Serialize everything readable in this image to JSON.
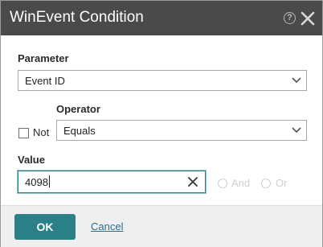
{
  "dialog": {
    "title": "WinEvent Condition"
  },
  "parameter": {
    "label": "Parameter",
    "selected": "Event ID"
  },
  "operator": {
    "label": "Operator",
    "selected": "Equals"
  },
  "not_checkbox": {
    "label": "Not",
    "checked": false
  },
  "value_field": {
    "label": "Value",
    "value": "4098"
  },
  "logic": {
    "and_label": "And",
    "or_label": "Or",
    "enabled": false
  },
  "footer": {
    "ok_label": "OK",
    "cancel_label": "Cancel"
  },
  "icons": {
    "help": "help-circle-icon",
    "close": "close-icon",
    "dropdown": "chevron-down-icon",
    "clear": "clear-x-icon"
  },
  "colors": {
    "titlebar": "#4a4a4a",
    "accent": "#2b7f86",
    "link": "#2a6e8f",
    "footer": "#efefef"
  }
}
